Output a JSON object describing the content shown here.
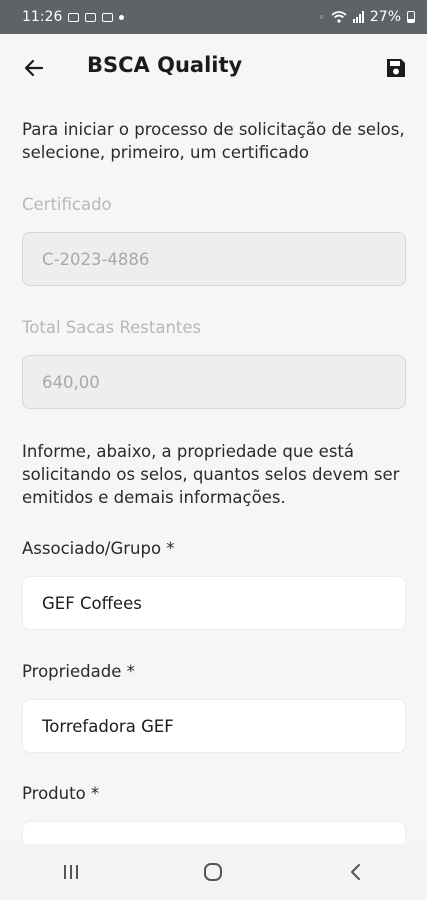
{
  "status_bar": {
    "time": "11:26",
    "battery": "27%"
  },
  "app_bar": {
    "title": "BSCA Quality",
    "back_icon": "arrow-left-icon",
    "save_icon": "floppy-disk-icon"
  },
  "intro_text": "Para iniciar o processo de solicitação de selos, selecione, primeiro, um certificado",
  "certificado": {
    "label": "Certificado",
    "value": "C-2023-4886"
  },
  "total_sacas": {
    "label": "Total Sacas Restantes",
    "value": "640,00"
  },
  "info_text": "Informe, abaixo, a propriedade que está solicitando os selos, quantos selos devem ser emitidos e demais informações.",
  "associado": {
    "label": "Associado/Grupo *",
    "value": "GEF Coffees"
  },
  "propriedade": {
    "label": "Propriedade *",
    "value": "Torrefadora GEF"
  },
  "produto": {
    "label": "Produto *",
    "value": ""
  },
  "colors": {
    "status_bar": "#5f6368",
    "background": "#f6f6f6",
    "disabled_field": "#eeeeee"
  }
}
